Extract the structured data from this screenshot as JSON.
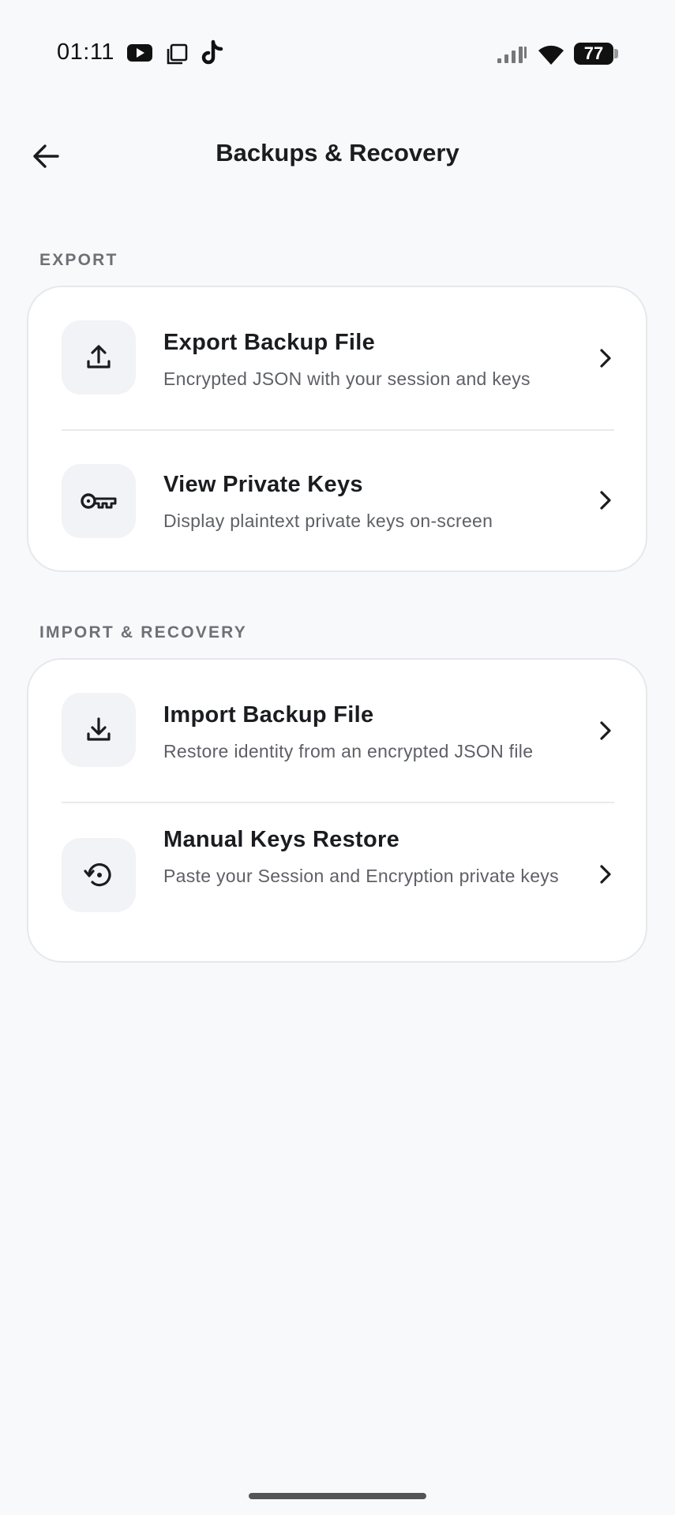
{
  "status_bar": {
    "time": "01:11",
    "battery": "77",
    "icons": [
      "youtube-icon",
      "copy-icon",
      "tiktok-icon",
      "signal-icon",
      "wifi-icon",
      "battery-icon"
    ]
  },
  "header": {
    "title": "Backups & Recovery",
    "back_icon": "arrow-left-icon"
  },
  "sections": [
    {
      "label": "EXPORT",
      "items": [
        {
          "title": "Export Backup File",
          "subtitle": "Encrypted JSON with your session and keys",
          "icon": "upload-icon"
        },
        {
          "title": "View Private Keys",
          "subtitle": "Display plaintext private keys on-screen",
          "icon": "key-icon"
        }
      ]
    },
    {
      "label": "IMPORT & RECOVERY",
      "items": [
        {
          "title": "Import Backup File",
          "subtitle": "Restore identity from an encrypted JSON file",
          "icon": "download-icon"
        },
        {
          "title": "Manual Keys Restore",
          "subtitle": "Paste your Session and Encryption private keys",
          "icon": "restore-icon"
        }
      ]
    }
  ],
  "colors": {
    "background": "#f8f9fb",
    "card": "#ffffff",
    "icon_tile": "#f2f3f6",
    "section_label": "#6e7076",
    "text_primary": "#1b1c1f",
    "text_secondary": "#5e6066"
  }
}
